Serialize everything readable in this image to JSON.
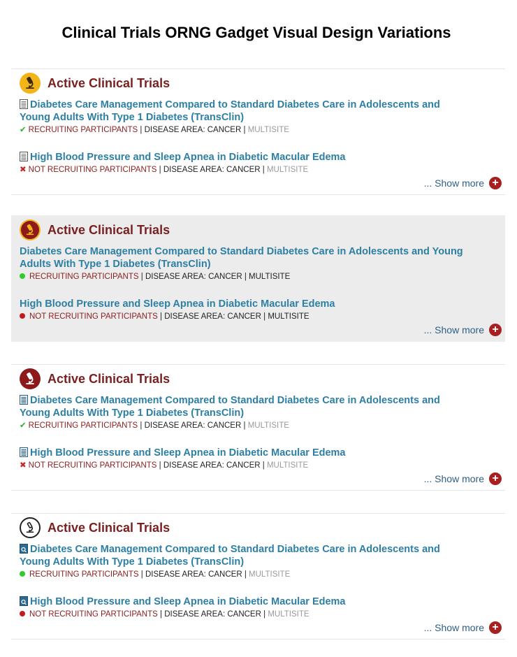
{
  "page": {
    "title": "Clinical Trials ORNG Gadget Visual Design Variations"
  },
  "panels": [
    {
      "header": "Active Clinical Trials",
      "trials": [
        {
          "title": "Diabetes Care Management Compared to Standard Diabetes Care in Adolescents and Young Adults With Type 1 Diabetes (TransClin)",
          "status": "RECRUITING PARTICIPANTS",
          "separator": "|",
          "disease_area": "DISEASE AREA: CANCER",
          "site": "MULTISITE"
        },
        {
          "title": "High Blood Pressure and Sleep Apnea in Diabetic Macular Edema",
          "status": "NOT RECRUITING PARTICIPANTS",
          "separator": "|",
          "disease_area": "DISEASE AREA: CANCER",
          "site": "MULTISITE"
        }
      ],
      "show_more": "... Show more"
    },
    {
      "header": "Active Clinical Trials",
      "trials": [
        {
          "title": "Diabetes Care Management Compared to Standard Diabetes Care in Adolescents and Young Adults With Type 1 Diabetes (TransClin)",
          "status": "RECRUITING PARTICIPANTS",
          "separator": "|",
          "disease_area": "DISEASE AREA: CANCER",
          "site": "MULTISITE"
        },
        {
          "title": "High Blood Pressure and Sleep Apnea in Diabetic Macular Edema",
          "status": "NOT RECRUITING PARTICIPANTS",
          "separator": "|",
          "disease_area": "DISEASE AREA: CANCER",
          "site": "MULTISITE"
        }
      ],
      "show_more": "... Show more"
    },
    {
      "header": "Active Clinical Trials",
      "trials": [
        {
          "title": "Diabetes Care Management Compared to Standard Diabetes Care in Adolescents and Young Adults With Type 1 Diabetes (TransClin)",
          "status": "RECRUITING PARTICIPANTS",
          "separator": "|",
          "disease_area": "DISEASE AREA: CANCER",
          "site": "MULTISITE"
        },
        {
          "title": "High Blood Pressure and Sleep Apnea in Diabetic Macular Edema",
          "status": "NOT RECRUITING PARTICIPANTS",
          "separator": "|",
          "disease_area": "DISEASE AREA: CANCER",
          "site": "MULTISITE"
        }
      ],
      "show_more": "... Show more"
    },
    {
      "header": "Active Clinical Trials",
      "trials": [
        {
          "title": "Diabetes Care Management Compared to Standard Diabetes Care in Adolescents and Young Adults With Type 1 Diabetes (TransClin)",
          "status": "RECRUITING PARTICIPANTS",
          "separator": "|",
          "disease_area": "DISEASE AREA: CANCER",
          "site": "MULTISITE"
        },
        {
          "title": "High Blood Pressure and Sleep Apnea in Diabetic Macular Edema",
          "status": "NOT RECRUITING PARTICIPANTS",
          "separator": "|",
          "disease_area": "DISEASE AREA: CANCER",
          "site": "MULTISITE"
        }
      ],
      "show_more": "... Show more"
    }
  ],
  "icons": {
    "header": "microscope-icon",
    "document": "document-icon",
    "recruiting": "checkmark-icon",
    "not_recruiting": "cross-icon",
    "show_more": "plus-circle-icon"
  },
  "colors": {
    "header_text": "#7a1f1f",
    "link": "#2d7fa3",
    "status": "#8c2121",
    "accent_yellow": "#f2b418",
    "accent_maroon": "#8c1a1a",
    "check_green": "#2db02d",
    "dot_green": "#2fcb2f",
    "dot_red": "#c21c1c",
    "panel_shade": "#ececec"
  }
}
